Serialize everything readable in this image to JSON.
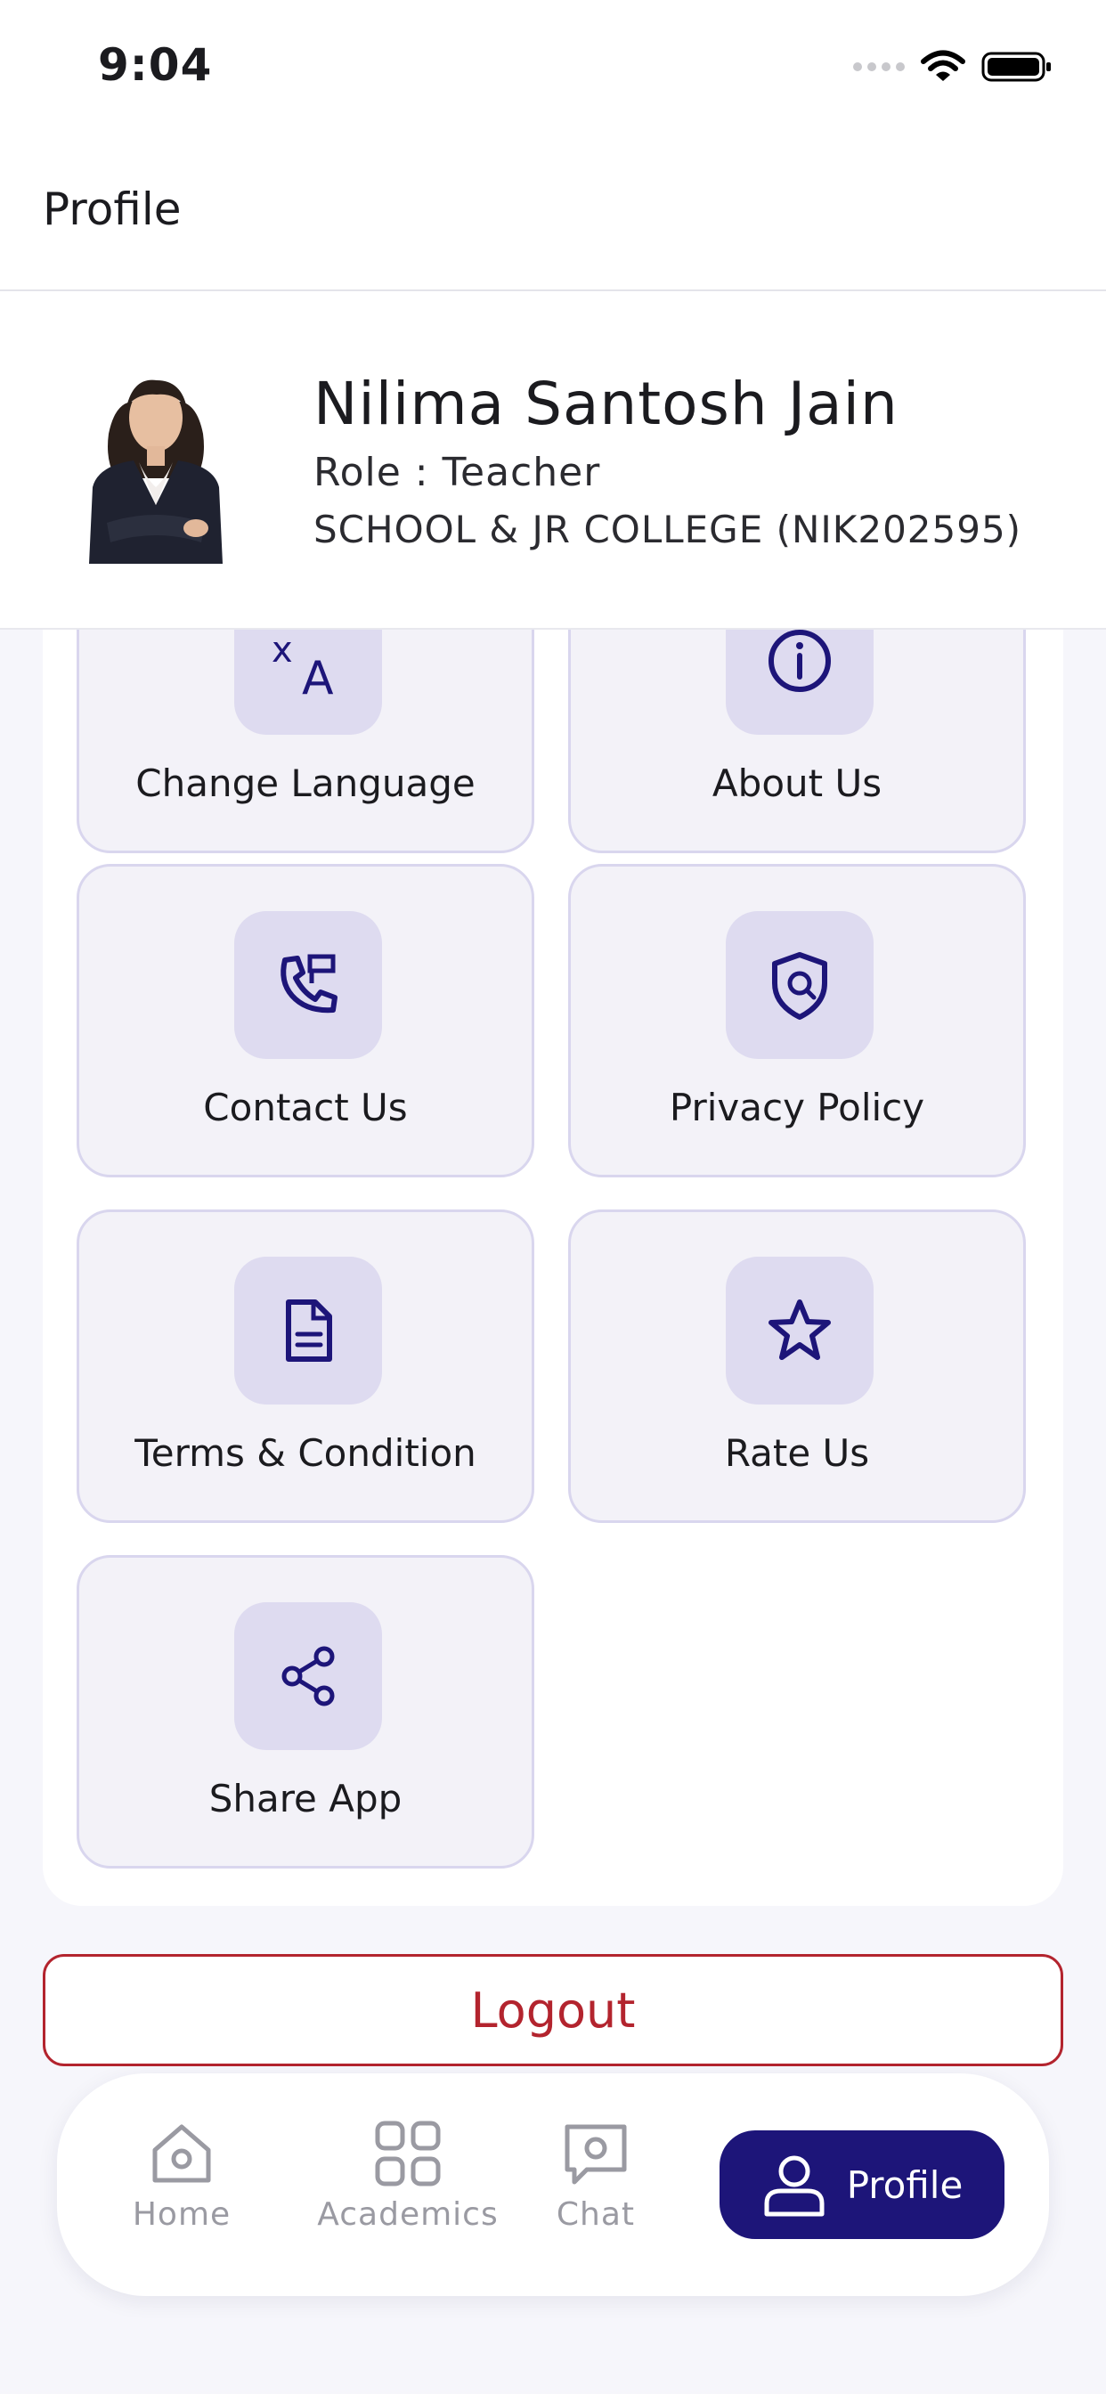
{
  "status_bar": {
    "time": "9:04"
  },
  "header": {
    "title": "Profile"
  },
  "profile": {
    "name": "Nilima Santosh Jain",
    "role": "Role : Teacher",
    "school": "SCHOOL & JR COLLEGE (NIK202595)"
  },
  "menu": {
    "items": [
      {
        "label": "Change Language",
        "icon": "translate-icon"
      },
      {
        "label": "About Us",
        "icon": "info-icon"
      },
      {
        "label": "Contact Us",
        "icon": "phone-contact-icon"
      },
      {
        "label": "Privacy Policy",
        "icon": "shield-search-icon"
      },
      {
        "label": "Terms & Condition",
        "icon": "document-icon"
      },
      {
        "label": "Rate Us",
        "icon": "star-icon"
      },
      {
        "label": "Share App",
        "icon": "share-icon"
      }
    ]
  },
  "logout_label": "Logout",
  "nav": {
    "items": [
      {
        "label": "Home",
        "icon": "home-icon"
      },
      {
        "label": "Academics",
        "icon": "grid-icon"
      },
      {
        "label": "Chat",
        "icon": "chat-icon"
      },
      {
        "label": "Profile",
        "icon": "user-icon",
        "active": true
      }
    ]
  },
  "colors": {
    "accent": "#1d1579",
    "logout": "#b3242e",
    "tile_bg": "#f3f2f8",
    "icon_bg": "#dedbf0"
  }
}
